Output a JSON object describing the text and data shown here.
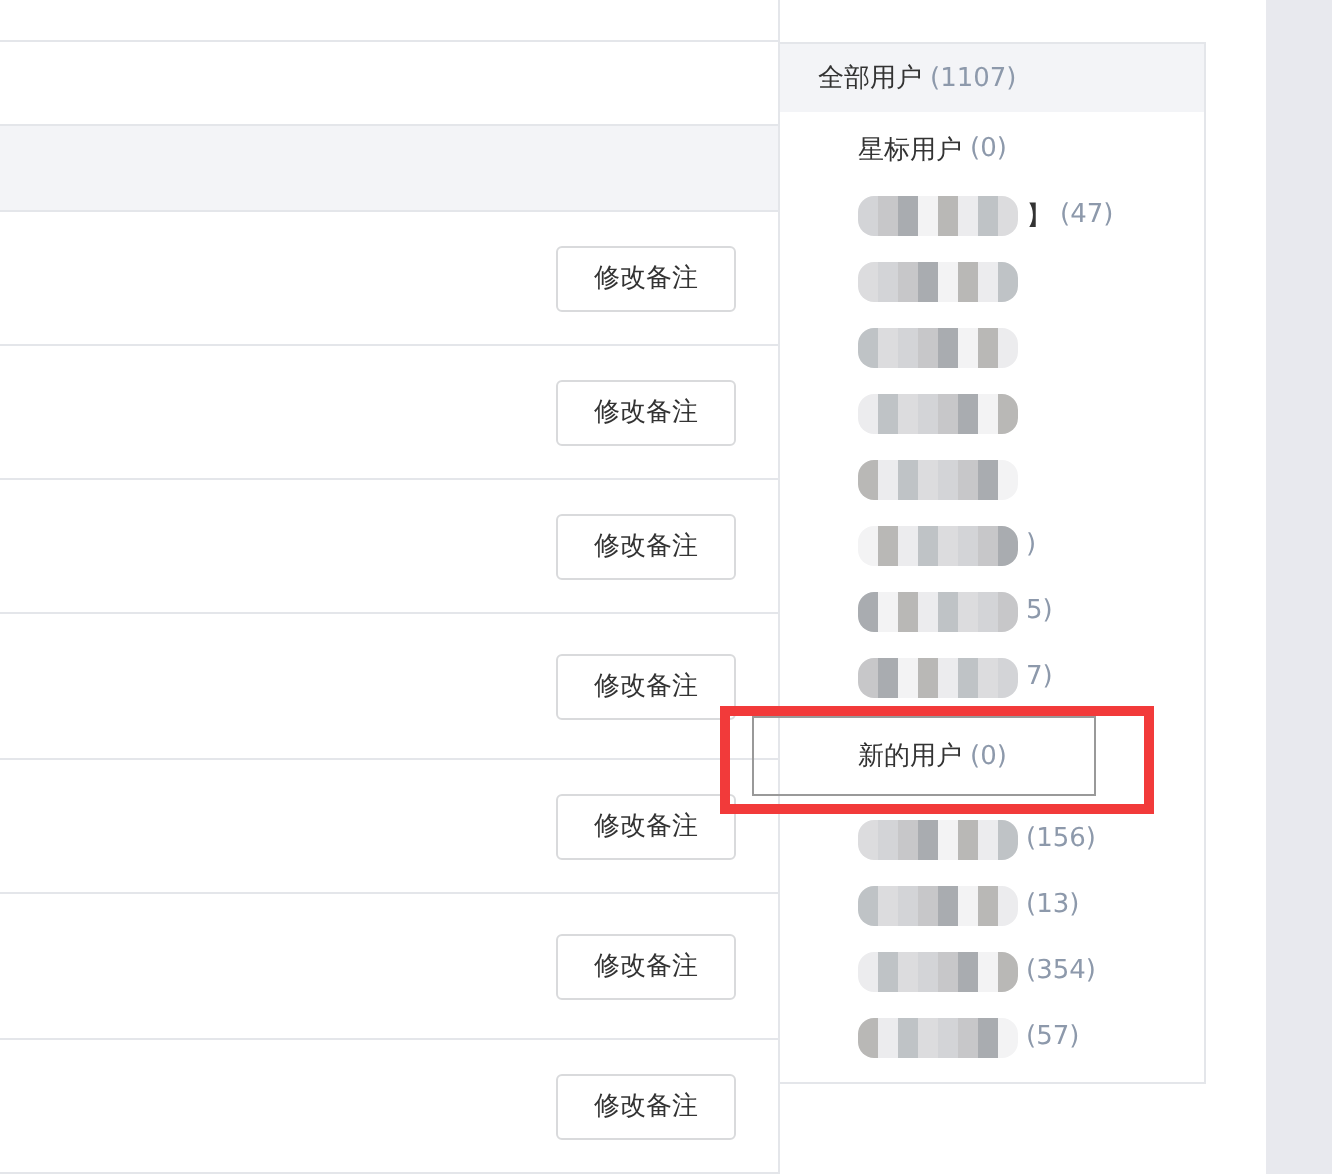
{
  "user_list": {
    "rows": [
      {
        "button": "修改备注"
      },
      {
        "button": "修改备注"
      },
      {
        "button": "修改备注"
      },
      {
        "button": "修改备注"
      },
      {
        "button": "修改备注"
      },
      {
        "button": "修改备注"
      },
      {
        "button": "修改备注"
      }
    ]
  },
  "sidebar": {
    "header": {
      "label": "全部用户",
      "count": "(1107)"
    },
    "items": [
      {
        "kind": "text",
        "label": "星标用户",
        "count": "(0)",
        "highlighted": false
      },
      {
        "kind": "redacted",
        "label": "】",
        "count": "(47)",
        "highlighted": false
      },
      {
        "kind": "redacted",
        "highlighted": false
      },
      {
        "kind": "redacted",
        "highlighted": false
      },
      {
        "kind": "redacted",
        "highlighted": false
      },
      {
        "kind": "redacted",
        "highlighted": false
      },
      {
        "kind": "redacted",
        "count": ")",
        "highlighted": false
      },
      {
        "kind": "redacted",
        "count": "5)",
        "highlighted": false
      },
      {
        "kind": "redacted",
        "count": "7)",
        "highlighted": false
      },
      {
        "kind": "text",
        "label": "新的用户",
        "count": "(0)",
        "highlighted": true
      },
      {
        "kind": "redacted",
        "count": "(156)",
        "highlighted": false
      },
      {
        "kind": "redacted",
        "count": "(13)",
        "highlighted": false
      },
      {
        "kind": "redacted",
        "count": "(354)",
        "highlighted": false
      },
      {
        "kind": "redacted",
        "count": "(57)",
        "highlighted": false
      }
    ]
  }
}
